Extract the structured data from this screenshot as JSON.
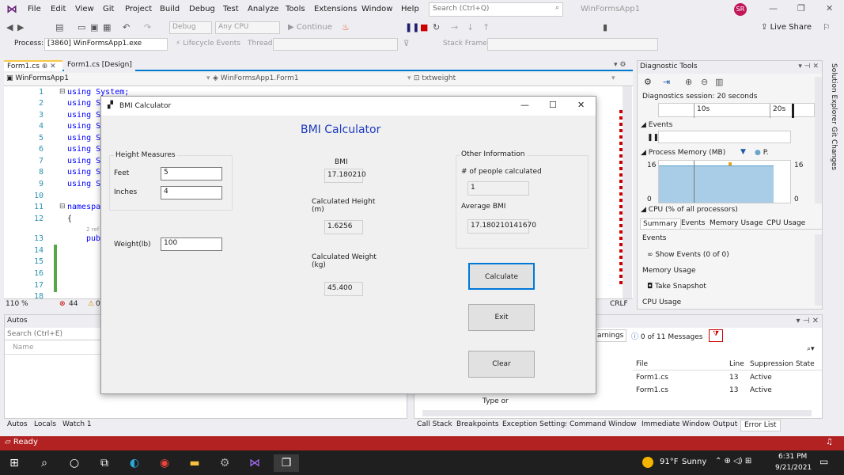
{
  "ide": {
    "menu": [
      "File",
      "Edit",
      "View",
      "Git",
      "Project",
      "Build",
      "Debug",
      "Test",
      "Analyze",
      "Tools",
      "Extensions",
      "Window",
      "Help"
    ],
    "search_placeholder": "Search (Ctrl+Q)",
    "window_title": "WinFormsApp1",
    "user_initials": "SR",
    "live_share": "Live Share",
    "toolbar": {
      "config": "Debug",
      "platform": "Any CPU",
      "continue": "Continue"
    },
    "process_label": "Process:",
    "process_value": "[3860] WinFormsApp1.exe",
    "lifecycle": "Lifecycle Events",
    "thread_label": "Thread:",
    "stack_frame_label": "Stack Frame:"
  },
  "editor": {
    "tabs": [
      "Form1.cs",
      "Form1.cs [Design]"
    ],
    "nav": {
      "project": "WinFormsApp1",
      "class": "WinFormsApp1.Form1",
      "member": "txtweight"
    },
    "lines": [
      {
        "n": "1",
        "code": "using System;"
      },
      {
        "n": "2",
        "code": "using S"
      },
      {
        "n": "3",
        "code": "using S"
      },
      {
        "n": "4",
        "code": "using S"
      },
      {
        "n": "5",
        "code": "using S"
      },
      {
        "n": "6",
        "code": "using S"
      },
      {
        "n": "7",
        "code": "using S"
      },
      {
        "n": "8",
        "code": "using S"
      },
      {
        "n": "9",
        "code": "using S"
      },
      {
        "n": "10",
        "code": ""
      },
      {
        "n": "11",
        "code": "namespa"
      },
      {
        "n": "12",
        "code": "{"
      },
      {
        "n": "13",
        "code": "pub"
      },
      {
        "n": "14",
        "code": ""
      },
      {
        "n": "15",
        "code": ""
      },
      {
        "n": "16",
        "code": ""
      },
      {
        "n": "17",
        "code": ""
      },
      {
        "n": "18",
        "code": ""
      }
    ],
    "refs": "2 ref",
    "zoom": "110 %",
    "errors": "44",
    "warnings": "0",
    "line_ending": "CRLF"
  },
  "diagnostics": {
    "title": "Diagnostic Tools",
    "session": "Diagnostics session: 20 seconds",
    "timeline": [
      "10s",
      "20s"
    ],
    "events": "Events",
    "process_memory": "Process Memory (MB)",
    "mem_legend": "P.",
    "mem_max": "16",
    "mem_min": "0",
    "cpu": "CPU (% of all processors)",
    "tabs": [
      "Summary",
      "Events",
      "Memory Usage",
      "CPU Usage"
    ],
    "section_events": "Events",
    "show_events": "Show Events (0 of 0)",
    "section_memory": "Memory Usage",
    "take_snapshot": "Take Snapshot",
    "section_cpu": "CPU Usage"
  },
  "autos": {
    "title": "Autos",
    "search_placeholder": "Search (Ctrl+E)",
    "col_name": "Name",
    "tabs": [
      "Autos",
      "Locals",
      "Watch 1"
    ]
  },
  "errorlist": {
    "warnings_label": "arnings",
    "messages": "0 of 11 Messages",
    "columns": [
      "File",
      "Line",
      "Suppression State"
    ],
    "rows": [
      {
        "file": "Form1.cs",
        "line": "13",
        "state": "Active"
      },
      {
        "file": "Form1.cs",
        "line": "13",
        "state": "Active"
      }
    ],
    "type_hint": "Type or",
    "tabs": [
      "Call Stack",
      "Breakpoints",
      "Exception Settings",
      "Command Window",
      "Immediate Window",
      "Output",
      "Error List"
    ]
  },
  "status": {
    "text": "Ready"
  },
  "taskbar": {
    "weather_temp": "91°F",
    "weather_desc": "Sunny",
    "time": "6:31 PM",
    "date": "9/21/2021"
  },
  "form": {
    "title": "BMI Calculator",
    "heading": "BMI Calculator",
    "height_group": "Height Measures",
    "feet_label": "Feet",
    "feet_value": "5",
    "inches_label": "Inches",
    "inches_value": "4",
    "weight_label": "Weight(lb)",
    "weight_value": "100",
    "bmi_label": "BMI",
    "bmi_value": "17.180210",
    "calc_height_label": "Calculated Height (m)",
    "calc_height_value": "1.6256",
    "calc_weight_label": "Calculated Weight (kg)",
    "calc_weight_value": "45.400",
    "other_group": "Other Information",
    "people_label": "# of people calculated",
    "people_value": "1",
    "avg_label": "Average BMI",
    "avg_value": "17.180210141670",
    "btn_calculate": "Calculate",
    "btn_exit": "Exit",
    "btn_clear": "Clear"
  }
}
